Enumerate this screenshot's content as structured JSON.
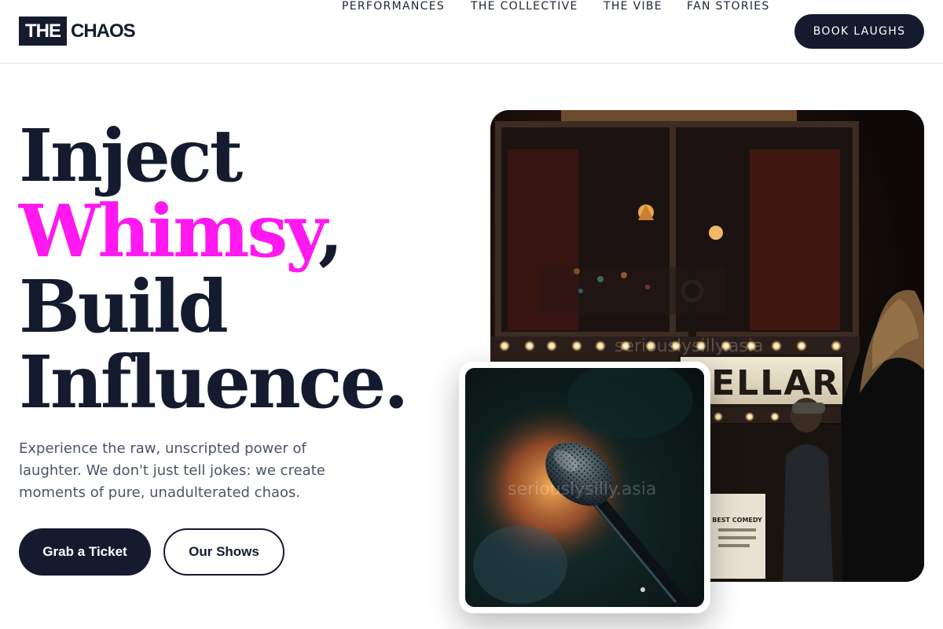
{
  "brand": {
    "logo_box": "THE",
    "logo_rest": "CHAOS"
  },
  "nav": {
    "items": [
      {
        "label": "PERFORMANCES"
      },
      {
        "label": "THE COLLECTIVE"
      },
      {
        "label": "THE VIBE"
      },
      {
        "label": "FAN STORIES"
      }
    ],
    "cta_label": "BOOK LAUGHS"
  },
  "hero": {
    "headline_line1": "Inject",
    "headline_accent": "Whimsy",
    "headline_comma": ",",
    "headline_line3": "Build",
    "headline_line4": "Influence.",
    "tagline": "Experience the raw, unscripted power of laughter. We don't just tell jokes: we create moments of pure, unadulterated chaos.",
    "primary_button": "Grab a Ticket",
    "secondary_button": "Our Shows"
  },
  "images": {
    "main_photo_sign": "CELLAR",
    "poster_text": "BEST COMEDY",
    "watermark": "seriouslysilly.asia"
  },
  "colors": {
    "navy": "#141b2e",
    "accent_magenta": "#ff18f0",
    "body_text": "#4b5568"
  }
}
